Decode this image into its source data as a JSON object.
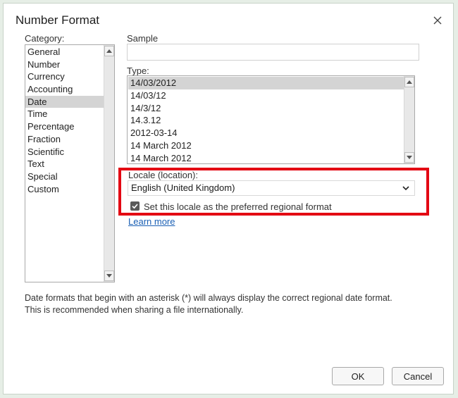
{
  "dialog": {
    "title": "Number Format"
  },
  "category": {
    "label": "Category:",
    "items": [
      "General",
      "Number",
      "Currency",
      "Accounting",
      "Date",
      "Time",
      "Percentage",
      "Fraction",
      "Scientific",
      "Text",
      "Special",
      "Custom"
    ],
    "selected": "Date"
  },
  "sample": {
    "label": "Sample",
    "value": ""
  },
  "type": {
    "label": "Type:",
    "items": [
      "14/03/2012",
      "14/03/12",
      "14/3/12",
      "14.3.12",
      "2012-03-14",
      "14 March 2012",
      "14 March 2012"
    ],
    "selected": "14/03/2012"
  },
  "locale": {
    "label": "Locale (location):",
    "value": "English (United Kingdom)",
    "checkbox_label": "Set this locale as the preferred regional format",
    "checkbox_checked": true
  },
  "learn_more": "Learn more",
  "note": {
    "line1": "Date formats that begin with an asterisk (*) will always display the correct regional date format.",
    "line2": "This is recommended when sharing a file internationally."
  },
  "buttons": {
    "ok": "OK",
    "cancel": "Cancel"
  },
  "colors": {
    "highlight_frame": "#e30613",
    "link": "#1a5fb4",
    "selection": "#d4d4d4"
  },
  "icons": [
    "close-icon",
    "chevron-down-icon",
    "checkmark-icon",
    "scroll-up-arrow-icon",
    "scroll-down-arrow-icon"
  ]
}
